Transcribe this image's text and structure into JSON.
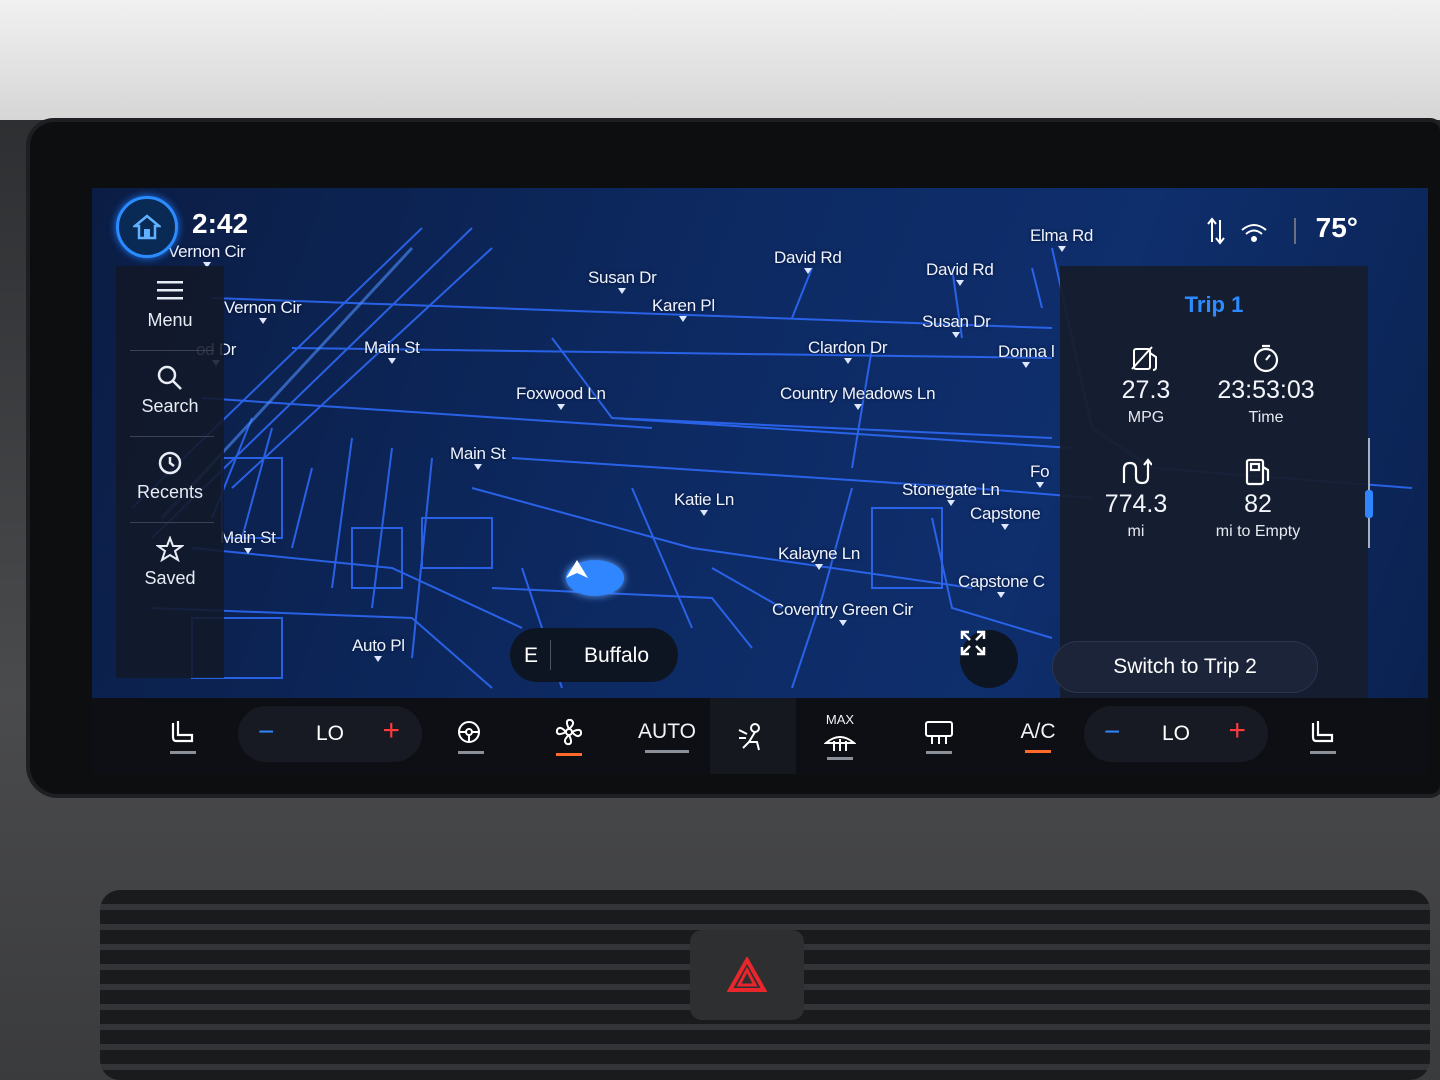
{
  "status_bar": {
    "time": "2:42",
    "temperature": "75°"
  },
  "sidebar": {
    "items": [
      {
        "label": "Menu",
        "icon": "menu-icon"
      },
      {
        "label": "Search",
        "icon": "search-icon"
      },
      {
        "label": "Recents",
        "icon": "history-icon"
      },
      {
        "label": "Saved",
        "icon": "star-icon"
      }
    ]
  },
  "map": {
    "road_labels": [
      "Vernon Cir",
      "Vernon Cir",
      "od Dr",
      "Main St",
      "Susan Dr",
      "Karen Pl",
      "David Rd",
      "David Rd",
      "Elma Rd",
      "Susan Dr",
      "Clardon Dr",
      "Donna l",
      "Foxwood Ln",
      "Country Meadows Ln",
      "Main St",
      "Katie Ln",
      "Stonegate Ln",
      "Fo",
      "Capstone",
      "Main St",
      "Kalayne Ln",
      "Capstone C",
      "Coventry Green Cir",
      "Auto Pl"
    ],
    "destination": {
      "direction": "E",
      "name": "Buffalo"
    }
  },
  "trip_panel": {
    "title": "Trip 1",
    "stats": [
      {
        "value": "27.3",
        "label": "MPG",
        "icon": "fuel-economy-icon"
      },
      {
        "value": "23:53:03",
        "label": "Time",
        "icon": "stopwatch-icon"
      },
      {
        "value": "774.3",
        "label": "mi",
        "icon": "distance-icon"
      },
      {
        "value": "82",
        "label": "mi to Empty",
        "icon": "fuel-pump-icon"
      }
    ],
    "switch_label": "Switch to Trip 2"
  },
  "climate": {
    "driver_temp": "LO",
    "passenger_temp": "LO",
    "auto_label": "AUTO",
    "max_label": "MAX",
    "ac_label": "A/C"
  },
  "colors": {
    "accent": "#2c8cff",
    "increase": "#ff3a3a",
    "active_indicator": "#ff6a2a",
    "map_bg": "#0d2a63"
  }
}
